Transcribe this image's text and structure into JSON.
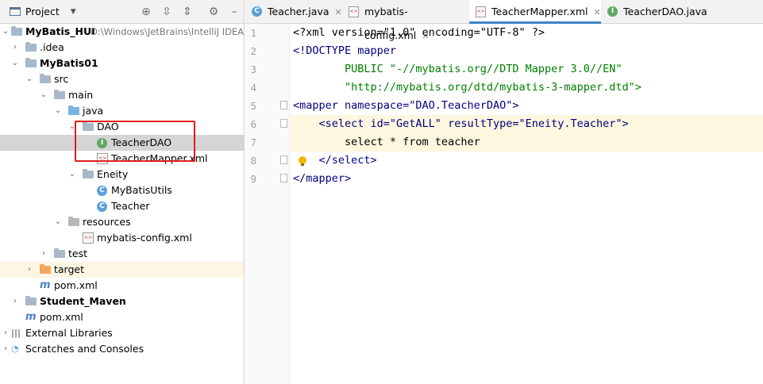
{
  "project_panel": {
    "title": "Project",
    "tree": [
      {
        "label": "MyBatis_HUI",
        "hint": "D:\\Windows\\JetBrains\\IntelliJ IDEA",
        "icon": "module-folder-icon",
        "expanded": true
      },
      {
        "label": ".idea",
        "icon": "folder-icon",
        "expanded": false
      },
      {
        "label": "MyBatis01",
        "icon": "module-folder-icon",
        "expanded": true
      },
      {
        "label": "src",
        "icon": "folder-icon",
        "expanded": true
      },
      {
        "label": "main",
        "icon": "folder-icon",
        "expanded": true
      },
      {
        "label": "java",
        "icon": "source-folder-icon",
        "expanded": true
      },
      {
        "label": "DAO",
        "icon": "package-icon",
        "expanded": true
      },
      {
        "label": "TeacherDAO",
        "icon": "interface-icon",
        "selected": true
      },
      {
        "label": "TeacherMapper.xml",
        "icon": "xml-file-icon"
      },
      {
        "label": "Eneity",
        "icon": "package-icon",
        "expanded": true
      },
      {
        "label": "MyBatisUtils",
        "icon": "class-icon"
      },
      {
        "label": "Teacher",
        "icon": "class-icon"
      },
      {
        "label": "resources",
        "icon": "resources-folder-icon",
        "expanded": true
      },
      {
        "label": "mybatis-config.xml",
        "icon": "xml-file-icon"
      },
      {
        "label": "test",
        "icon": "folder-icon",
        "expanded": false
      },
      {
        "label": "target",
        "icon": "excluded-folder-icon",
        "expanded": false
      },
      {
        "label": "pom.xml",
        "icon": "maven-icon"
      },
      {
        "label": "Student_Maven",
        "icon": "module-folder-icon",
        "expanded": false
      },
      {
        "label": "pom.xml",
        "icon": "maven-icon"
      },
      {
        "label": "External Libraries",
        "icon": "libraries-icon",
        "expanded": false
      },
      {
        "label": "Scratches and Consoles",
        "icon": "scratches-icon",
        "expanded": false
      }
    ]
  },
  "tabs": [
    {
      "label": "Teacher.java",
      "icon": "class-icon",
      "active": false
    },
    {
      "label": "mybatis-config.xml",
      "icon": "xml-file-icon",
      "active": false
    },
    {
      "label": "TeacherMapper.xml",
      "icon": "xml-file-icon",
      "active": true
    },
    {
      "label": "TeacherDAO.java",
      "icon": "interface-icon",
      "active": false
    }
  ],
  "colors": {
    "selection": "#d5d5d5",
    "highlight_line": "#fcf7de",
    "annotation_box": "#e21b1b",
    "tab_active_underline": "#4083c9"
  },
  "editor": {
    "line_numbers": [
      "1",
      "2",
      "3",
      "4",
      "5",
      "6",
      "7",
      "8",
      "9"
    ],
    "lines": [
      "<?xml version=\"1.0\" encoding=\"UTF-8\" ?>",
      "<!DOCTYPE mapper",
      "        PUBLIC \"-//mybatis.org//DTD Mapper 3.0//EN\"",
      "        \"http://mybatis.org/dtd/mybatis-3-mapper.dtd\">",
      "<mapper namespace=\"DAO.TeacherDAO\">",
      "    <select id=\"GetALL\" resultType=\"Eneity.Teacher\">",
      "        select * from teacher",
      "    </select>",
      "</mapper>"
    ]
  }
}
